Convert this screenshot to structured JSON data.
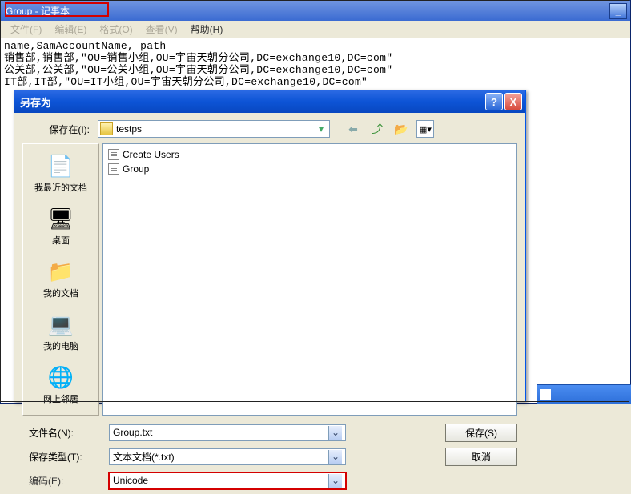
{
  "notepad": {
    "title": "Group - 记事本",
    "menu": [
      "文件(F)",
      "编辑(E)",
      "格式(O)",
      "查看(V)",
      "帮助(H)"
    ],
    "content": "name,SamAccountName, path\n销售部,销售部,\"OU=销售小组,OU=宇宙天朝分公司,DC=exchange10,DC=com\"\n公关部,公关部,\"OU=公关小组,OU=宇宙天朝分公司,DC=exchange10,DC=com\"\nIT部,IT部,\"OU=IT小组,OU=宇宙天朝分公司,DC=exchange10,DC=com\""
  },
  "dialog": {
    "title": "另存为",
    "lookin_label": "保存在(I):",
    "current_folder": "testps",
    "places": [
      {
        "label": "我最近的文档",
        "icon": "📄"
      },
      {
        "label": "桌面",
        "icon": "🖥"
      },
      {
        "label": "我的文档",
        "icon": "📁"
      },
      {
        "label": "我的电脑",
        "icon": "💻"
      },
      {
        "label": "网上邻居",
        "icon": "🌐"
      }
    ],
    "files": [
      "Create Users",
      "Group"
    ],
    "filename_label": "文件名(N):",
    "filename_value": "Group.txt",
    "filetype_label": "保存类型(T):",
    "filetype_value": "文本文档(*.txt)",
    "encoding_label": "编码(E):",
    "encoding_value": "Unicode",
    "save_btn": "保存(S)",
    "cancel_btn": "取消"
  },
  "icons": {
    "back": "⬅",
    "up": "⤴",
    "newfolder": "📂",
    "views": "▥"
  }
}
